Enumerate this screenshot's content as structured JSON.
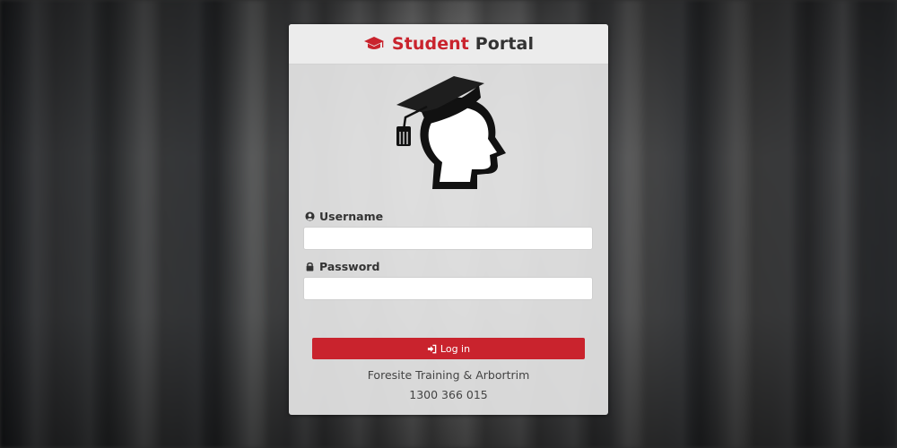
{
  "header": {
    "title_part1": "Student",
    "title_part2": "Portal",
    "icon": "graduation-cap-icon"
  },
  "logo": {
    "icon": "graduate-head-icon"
  },
  "form": {
    "username_label": "Username",
    "username_icon": "user-circle-icon",
    "username_value": "",
    "password_label": "Password",
    "password_icon": "lock-icon",
    "password_value": "",
    "login_label": "Log in",
    "login_icon": "sign-in-icon"
  },
  "footer": {
    "organization": "Foresite Training & Arbortrim",
    "phone": "1300 366 015"
  },
  "colors": {
    "accent": "#c9232d",
    "text_dark": "#333333",
    "card_bg": "#e4e4e4",
    "header_bg": "#ececec"
  }
}
